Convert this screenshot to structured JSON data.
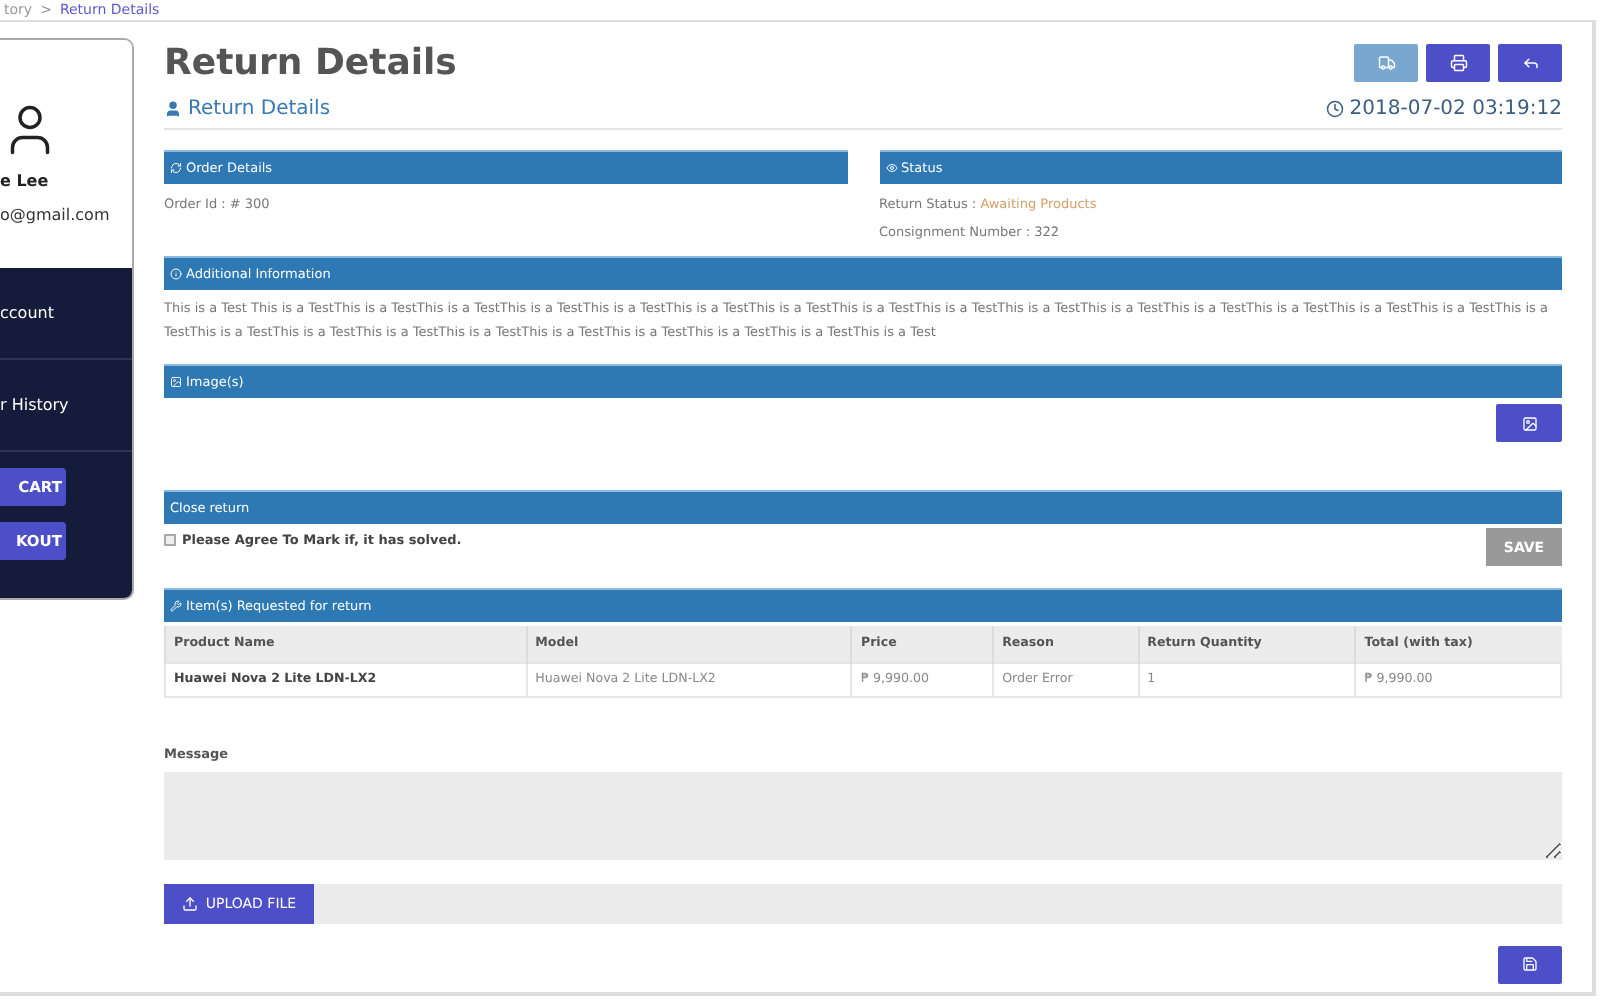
{
  "breadcrumb": {
    "items": [
      "tory",
      "Return Details"
    ],
    "separator": ">"
  },
  "sidebar": {
    "name": "e Lee",
    "email": "o@gmail.com",
    "menu": [
      "ccount",
      "r History"
    ],
    "buttons": [
      "CART",
      "KOUT"
    ]
  },
  "header": {
    "title": "Return Details",
    "subtitle": "Return Details",
    "datetime": "2018-07-02 03:19:12",
    "actions": [
      {
        "kind": "truck",
        "disabled": true
      },
      {
        "kind": "print",
        "disabled": false
      },
      {
        "kind": "reply",
        "disabled": false
      }
    ]
  },
  "order_details": {
    "title": "Order Details",
    "order_id": "Order Id : # 300"
  },
  "status": {
    "title": "Status",
    "return_status_label": "Return Status :",
    "return_status": "Awaiting Products",
    "consignment": "Consignment Number : 322"
  },
  "additional_info": {
    "title": "Additional Information",
    "text": "This is a Test This is a TestThis is a TestThis is a TestThis is a TestThis is a TestThis is a TestThis is a TestThis is a TestThis is a TestThis is a TestThis is a TestThis is a TestThis is a TestThis is a TestThis is a TestThis is a TestThis is a TestThis is a TestThis is a TestThis is a TestThis is a TestThis is a TestThis is a TestThis is a TestThis is a Test"
  },
  "images": {
    "title": "Image(s)"
  },
  "close_return": {
    "title": "Close return",
    "checkbox_label": "Please Agree To Mark if, it has solved.",
    "checked": false,
    "save_label": "SAVE"
  },
  "items": {
    "title": "Item(s) Requested for return",
    "columns": [
      "Product Name",
      "Model",
      "Price",
      "Reason",
      "Return Quantity",
      "Total (with tax)"
    ],
    "rows": [
      [
        "Huawei Nova 2 Lite LDN-LX2",
        "Huawei Nova 2 Lite LDN-LX2",
        "₱ 9,990.00",
        "Order Error",
        "1",
        "₱ 9,990.00"
      ]
    ]
  },
  "message": {
    "label": "Message"
  },
  "upload": {
    "label": "UPLOAD FILE"
  }
}
